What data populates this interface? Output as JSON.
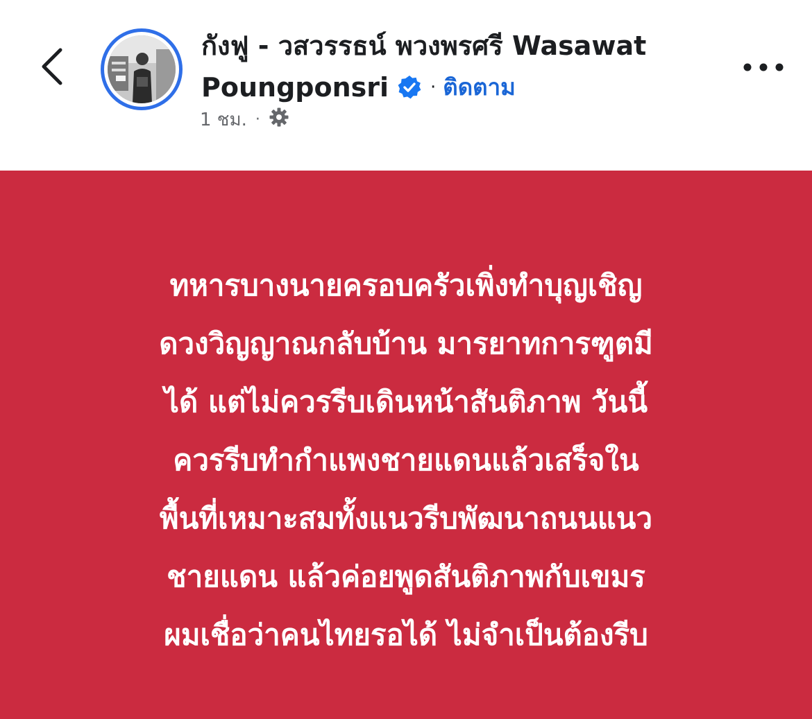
{
  "header": {
    "author_name_line1": "กังฟู - วสวรรธน์ พวงพรศรี   Wasawat",
    "author_name_line2": "Poungponsri",
    "separator": "·",
    "follow_label": "ติดตาม",
    "timestamp": "1 ชม.",
    "meta_separator": "·",
    "icons": {
      "back": "chevron-left-icon",
      "verified": "verified-badge-icon",
      "privacy": "gear-icon",
      "more": "more-horizontal-icon"
    },
    "colors": {
      "avatar_ring": "#2f6fe8",
      "verified": "#1877f2",
      "follow": "#1a66d6"
    }
  },
  "post": {
    "background": "#cb2b40",
    "lines": [
      "ทหารบางนายครอบครัวเพิ่งทำบุญเชิญ",
      "ดวงวิญญาณกลับบ้าน มารยาทการฑูตมี",
      "ได้ แต่ไม่ควรรีบเดินหน้าสันติภาพ วันนี้",
      "ควรรีบทำกำแพงชายแดนแล้วเสร็จใน",
      "พื้นที่เหมาะสมทั้งแนวรีบพัฒนาถนนแนว",
      "ชายแดน แล้วค่อยพูดสันติภาพกับเขมร",
      "ผมเชื่อว่าคนไทยรอได้ ไม่จำเป็นต้องรีบ"
    ]
  }
}
